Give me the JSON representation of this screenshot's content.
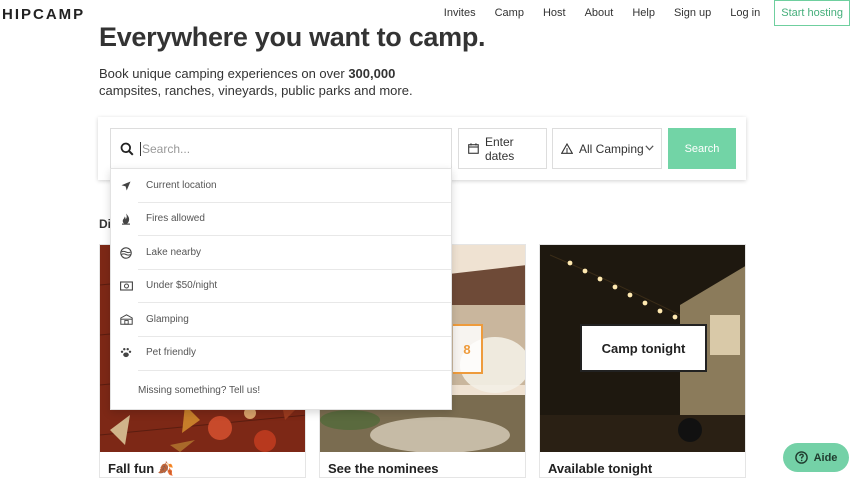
{
  "brand": {
    "logo_text": "HIPCAMP"
  },
  "nav": {
    "items": [
      "Invites",
      "Camp",
      "Host",
      "About",
      "Help",
      "Sign up",
      "Log in"
    ],
    "cta": "Start hosting"
  },
  "hero": {
    "title": "Everywhere you want to camp.",
    "subtitle_pre": "Book unique camping experiences on over ",
    "subtitle_bold": "300,000",
    "subtitle_post": " campsites, ranches, vineyards, public parks and more."
  },
  "search": {
    "placeholder": "Search...",
    "dates_label": "Enter dates",
    "camping_type": "All Camping",
    "button": "Search"
  },
  "section": {
    "heading_visible": "Di"
  },
  "dropdown": {
    "items": [
      {
        "icon": "location-arrow-icon",
        "label": "Current location"
      },
      {
        "icon": "fire-icon",
        "label": "Fires allowed"
      },
      {
        "icon": "lake-icon",
        "label": "Lake nearby"
      },
      {
        "icon": "money-icon",
        "label": "Under $50/night"
      },
      {
        "icon": "glamping-icon",
        "label": "Glamping"
      },
      {
        "icon": "paw-icon",
        "label": "Pet friendly"
      }
    ],
    "footer": "Missing something? Tell us!"
  },
  "cards": [
    {
      "title": "Fall fun 🍂",
      "overlay": ""
    },
    {
      "title": "See the nominees",
      "overlay": "8"
    },
    {
      "title": "Available tonight",
      "overlay": "Camp tonight"
    }
  ],
  "chat": {
    "label": "Aide"
  },
  "colors": {
    "accent": "#72d4a6",
    "orange": "#ee9b3c",
    "text": "#333333"
  }
}
